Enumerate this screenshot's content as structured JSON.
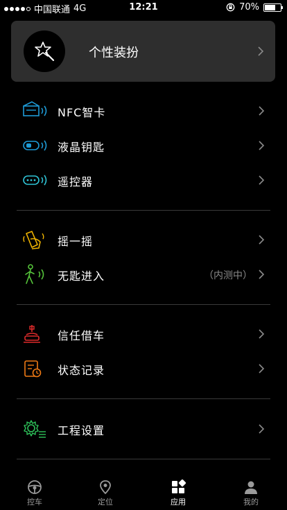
{
  "status_bar": {
    "carrier": "中国联通",
    "network": "4G",
    "time": "12:21",
    "battery": "70%",
    "battery_level": 0.7
  },
  "profile": {
    "label": "个性装扮",
    "icon": "magic-wand-icon"
  },
  "groups": [
    {
      "items": [
        {
          "label": "NFC智卡",
          "icon": "nfc-card-icon",
          "color": "#1e9bd7"
        },
        {
          "label": "液晶钥匙",
          "icon": "lcd-key-icon",
          "color": "#1e9bd7"
        },
        {
          "label": "遥控器",
          "icon": "remote-control-icon",
          "color": "#2fc4d6"
        }
      ]
    },
    {
      "items": [
        {
          "label": "摇一摇",
          "icon": "shake-icon",
          "color": "#f0b400"
        },
        {
          "label": "无匙进入",
          "icon": "keyless-entry-icon",
          "color": "#55c43a",
          "note": "（内测中）"
        }
      ]
    },
    {
      "items": [
        {
          "label": "信任借车",
          "icon": "trust-lend-icon",
          "color": "#e02b2b"
        },
        {
          "label": "状态记录",
          "icon": "status-record-icon",
          "color": "#f07a14"
        }
      ]
    },
    {
      "items": [
        {
          "label": "工程设置",
          "icon": "engineering-settings-icon",
          "color": "#2ec25a"
        }
      ]
    }
  ],
  "tabbar": {
    "tabs": [
      {
        "label": "控车",
        "icon": "steering-wheel-icon",
        "active": false
      },
      {
        "label": "定位",
        "icon": "location-pin-icon",
        "active": false
      },
      {
        "label": "应用",
        "icon": "apps-grid-icon",
        "active": true
      },
      {
        "label": "我的",
        "icon": "person-icon",
        "active": false
      }
    ]
  }
}
